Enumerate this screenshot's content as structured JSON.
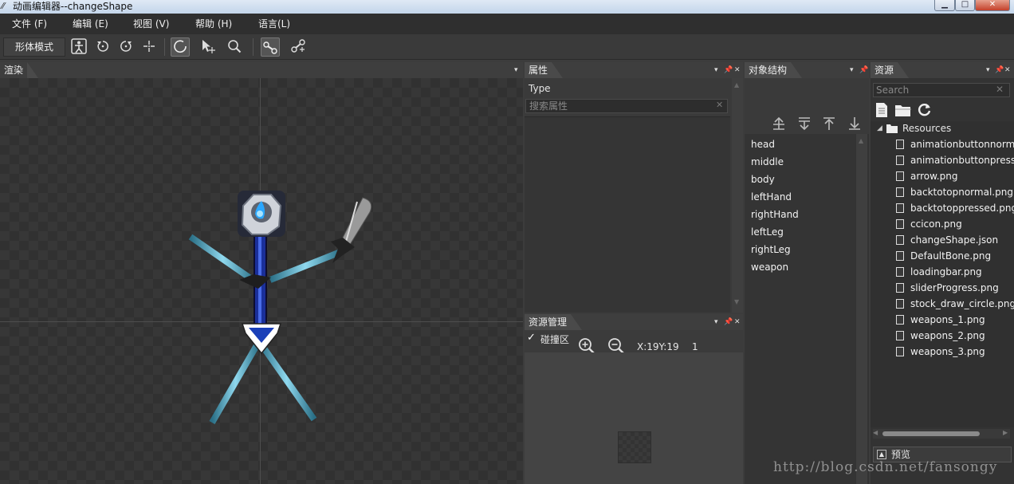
{
  "window": {
    "title": "动画编辑器--changeShape",
    "minimize_label": "▁",
    "maximize_label": "□",
    "close_label": "✕"
  },
  "menu": [
    "文件 (F)",
    "编辑 (E)",
    "视图 (V)",
    "帮助 (H)",
    "语言(L)"
  ],
  "toolbar": {
    "mode_label": "形体模式",
    "tools": [
      {
        "icon": "figure-icon"
      },
      {
        "icon": "rotate-ccw-icon"
      },
      {
        "icon": "rotate-cw-icon"
      },
      {
        "icon": "crosshair-icon"
      },
      {
        "icon": "circle-tool-icon"
      },
      {
        "icon": "select-arrow-icon"
      },
      {
        "icon": "zoom-icon"
      },
      {
        "icon": "bone-icon"
      },
      {
        "icon": "bone-link-icon"
      }
    ]
  },
  "render_panel": {
    "title": "渲染"
  },
  "properties_panel": {
    "title": "属性",
    "type_label": "Type",
    "search_placeholder": "搜索属性"
  },
  "resource_mgmt_panel": {
    "title": "资源管理",
    "collision_label": "碰撞区",
    "collision_checked": true,
    "coords": "X:19Y:19",
    "count": "1"
  },
  "object_panel": {
    "title": "对象结构",
    "items": [
      "head",
      "middle",
      "body",
      "leftHand",
      "rightHand",
      "leftLeg",
      "rightLeg",
      "weapon"
    ]
  },
  "resources_panel": {
    "title": "资源",
    "search_placeholder": "Search",
    "root": "Resources",
    "files": [
      "animationbuttonnormal.png",
      "animationbuttonpressed.png",
      "arrow.png",
      "backtotopnormal.png",
      "backtotoppressed.png",
      "ccicon.png",
      "changeShape.json",
      "DefaultBone.png",
      "loadingbar.png",
      "sliderProgress.png",
      "stock_draw_circle.png",
      "weapons_1.png",
      "weapons_2.png",
      "weapons_3.png"
    ],
    "preview_label": "预览"
  },
  "watermark": "http://blog.csdn.net/fansongy"
}
